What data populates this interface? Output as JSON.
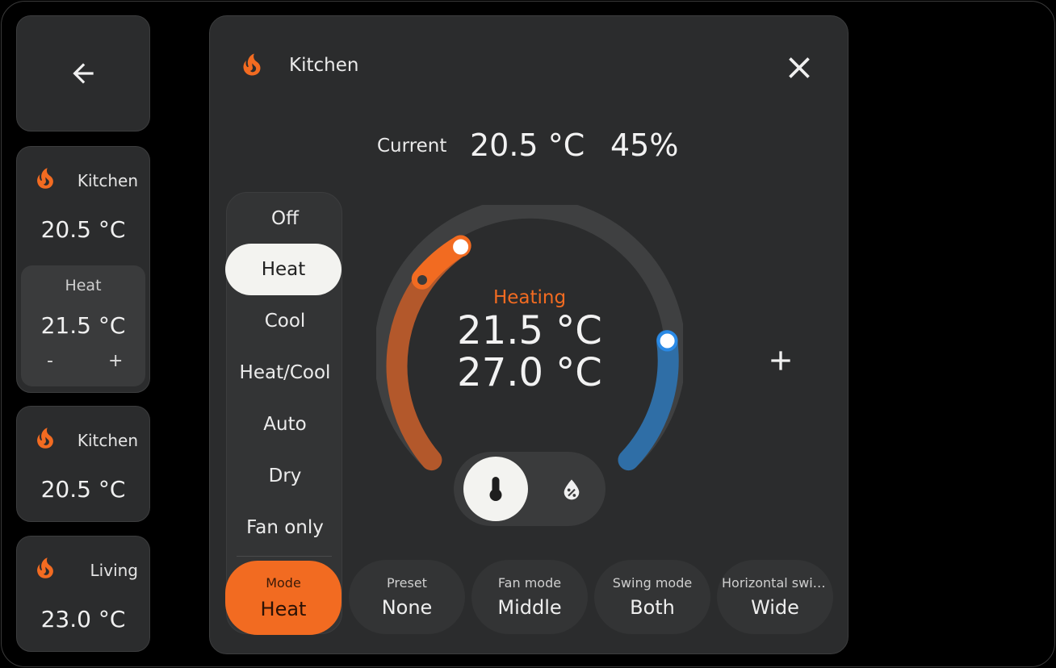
{
  "colors": {
    "accent": "#f26b21",
    "heat_arc": "#b3582b",
    "cool_arc": "#2f6ea6",
    "track": "#3f4041",
    "cool_handle": "#2a8ae6"
  },
  "sidebar": {
    "back_icon": "arrow-left-icon",
    "tiles": [
      {
        "name": "Kitchen",
        "temp": "20.5 °C",
        "icon": "flame-icon",
        "control": {
          "mode": "Heat",
          "target": "21.5 °C",
          "minus": "-",
          "plus": "+"
        }
      },
      {
        "name": "Kitchen",
        "temp": "20.5 °C",
        "icon": "flame-icon"
      },
      {
        "name": "Living",
        "temp": "23.0 °C",
        "icon": "flame-icon"
      }
    ]
  },
  "dialog": {
    "title": "Kitchen",
    "icon": "flame-icon",
    "close_icon": "close-icon",
    "current_label": "Current",
    "current_temp": "20.5 °C",
    "current_humidity": "45%",
    "modes": [
      "Off",
      "Heat",
      "Cool",
      "Heat/Cool",
      "Auto",
      "Dry",
      "Fan only"
    ],
    "selected_mode": "Heat",
    "mode_button": {
      "label": "Mode",
      "value": "Heat"
    },
    "gauge": {
      "action": "Heating",
      "target_low": "21.5 °C",
      "target_high": "27.0 °C",
      "current_value": 20.5,
      "low_value": 21.5,
      "high_value": 27.0
    },
    "toggle": {
      "temperature_icon": "thermometer-icon",
      "humidity_icon": "water-percent-icon"
    },
    "plus_icon": "plus-icon",
    "features": [
      {
        "label": "Preset",
        "value": "None"
      },
      {
        "label": "Fan mode",
        "value": "Middle"
      },
      {
        "label": "Swing mode",
        "value": "Both"
      },
      {
        "label": "Horizontal swing mode",
        "value": "Wide"
      }
    ]
  }
}
